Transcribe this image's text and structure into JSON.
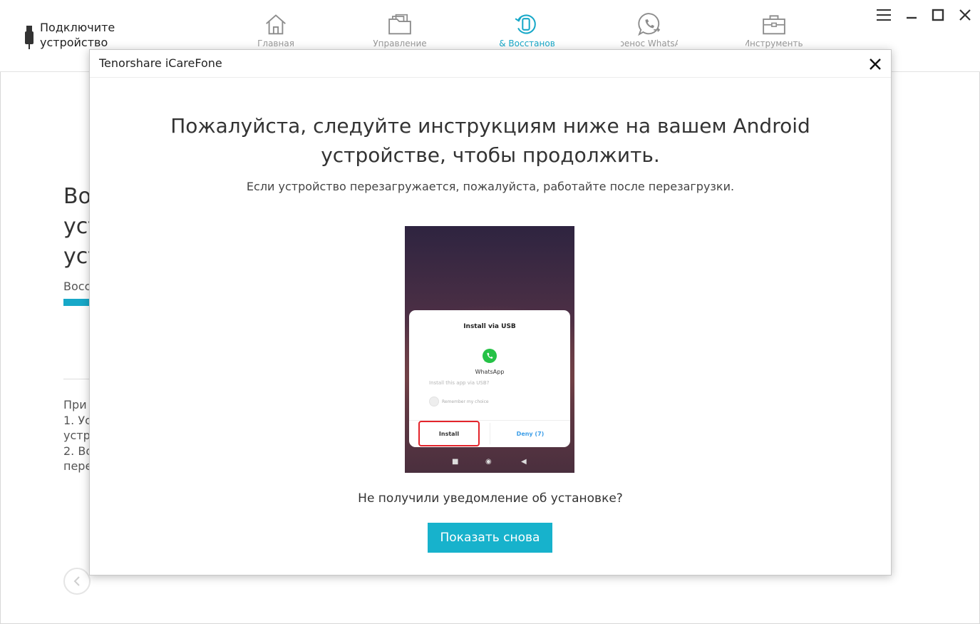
{
  "topbar": {
    "device_status": [
      "Подключите",
      "устройство"
    ],
    "tabs": [
      {
        "name": "home",
        "label": "Главная",
        "icon": "home-icon"
      },
      {
        "name": "manage",
        "label": "Управление",
        "icon": "folder-icon"
      },
      {
        "name": "backup",
        "label": "Бэкап & Восстановление",
        "icon": "backup-restore-icon",
        "active": true
      },
      {
        "name": "whatsapp",
        "label": "Перенос WhatsApp",
        "icon": "whatsapp-transfer-icon"
      },
      {
        "name": "toolkit",
        "label": "Инструменты",
        "icon": "toolbox-icon"
      }
    ],
    "window_controls": [
      "menu-icon",
      "minimize-icon",
      "maximize-icon",
      "close-icon"
    ]
  },
  "background": {
    "title_lines": [
      "Во",
      "уст",
      "уст"
    ],
    "subtitle": "Восс",
    "notes": [
      "При",
      "1. Ус",
      "устр",
      "2. Во",
      "пере"
    ]
  },
  "dialog": {
    "title": "Tenorshare iCareFone",
    "heading_lines": [
      "Пожалуйста, следуйте инструкциям ниже на вашем Android",
      "устройстве, чтобы продолжить."
    ],
    "note": "Если устройство перезагружается, пожалуйста, работайте после перезагрузки.",
    "phone": {
      "sheet_title": "Install via USB",
      "app_name": "WhatsApp",
      "question": "Install this app via USB?",
      "remember": "Remember my choice",
      "install": "Install",
      "deny": "Deny (7)"
    },
    "question": "Не получили уведомление об установке?",
    "button": "Показать снова"
  },
  "colors": {
    "accent": "#17b2cc",
    "highlight": "#e3242b",
    "deny": "#3d9ee8"
  }
}
